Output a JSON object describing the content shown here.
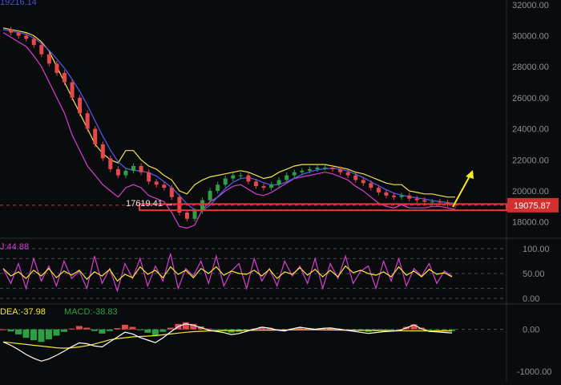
{
  "header": {
    "top_value_text": "19216.14"
  },
  "main_chart": {
    "price_axis_ticks": [
      "32000.00",
      "30000.00",
      "28000.00",
      "26000.00",
      "24000.00",
      "22000.00",
      "20000.00",
      "18000.00"
    ],
    "current_price": "19075.87",
    "low_annotation": "17619.41",
    "colors": {
      "background": "#0a0b0d",
      "candle_up": "#2ea043",
      "candle_down": "#e5484d",
      "upper_band": "#f2e34b",
      "lower_band": "#d63fd2",
      "ma": "#4f59e6",
      "support_box": "#e53935",
      "arrow": "#f5e92a",
      "price_tag": "#d32f2f"
    }
  },
  "stoch_panel": {
    "label": "J:44.88",
    "axis_ticks": [
      "100.00",
      "50.00",
      "0.00"
    ],
    "colors": {
      "k": "#f5e92a",
      "d": "#d63fd2"
    }
  },
  "macd_panel": {
    "dea_label": "DEA:-37.98",
    "macd_label": "MACD:-38.83",
    "axis_ticks": [
      "0.00",
      "-1000.00"
    ],
    "colors": {
      "dif": "#ffffff",
      "dea": "#f5e92a",
      "hist_up": "#2ea043",
      "hist_down": "#e5484d"
    }
  },
  "chart_data": [
    {
      "type": "candlestick",
      "y_ticks": [
        18000,
        20000,
        22000,
        24000,
        26000,
        28000,
        30000,
        32000
      ],
      "ylim": [
        17000,
        32300
      ],
      "grid": false,
      "series": [
        {
          "kind": "close",
          "values": [
            30400,
            30200,
            30000,
            29800,
            29400,
            28800,
            28200,
            27600,
            27000,
            26000,
            25000,
            24000,
            23000,
            22100,
            21400,
            21000,
            21300,
            21600,
            21200,
            20600,
            20400,
            20200,
            19600,
            18600,
            18200,
            18700,
            19400,
            20000,
            20400,
            20800,
            21000,
            21000,
            20600,
            20300,
            20200,
            20400,
            20700,
            21000,
            21200,
            21300,
            21400,
            21500,
            21500,
            21400,
            21200,
            21000,
            20700,
            20500,
            20200,
            19900,
            19700,
            19600,
            19700,
            19500,
            19400,
            19300,
            19300,
            19250,
            19150,
            19075.87
          ]
        },
        {
          "kind": "upper_band",
          "values": [
            30500,
            30400,
            30300,
            30200,
            30000,
            29600,
            29000,
            28000,
            27000,
            26000,
            25000,
            24000,
            23000,
            22400,
            22000,
            21800,
            22600,
            22600,
            22000,
            21600,
            21400,
            21000,
            20700,
            20000,
            19800,
            20400,
            20700,
            20900,
            21000,
            21100,
            21200,
            21300,
            21200,
            21000,
            20800,
            20900,
            21200,
            21400,
            21600,
            21700,
            21700,
            21700,
            21700,
            21600,
            21500,
            21400,
            21200,
            21100,
            20900,
            20700,
            20500,
            20400,
            20400,
            20000,
            19900,
            19800,
            19800,
            19700,
            19600,
            19600
          ]
        },
        {
          "kind": "lower_band",
          "values": [
            30200,
            29900,
            29600,
            29300,
            28700,
            28000,
            27000,
            26000,
            25000,
            23600,
            22600,
            21600,
            21000,
            20400,
            20000,
            19600,
            20200,
            20400,
            20200,
            19700,
            19500,
            19300,
            18600,
            17700,
            17600,
            17800,
            18800,
            19300,
            19600,
            20000,
            20300,
            20400,
            20100,
            19800,
            19700,
            19900,
            20200,
            20500,
            20800,
            20900,
            21000,
            21100,
            21200,
            21100,
            20900,
            20700,
            20300,
            20000,
            19600,
            19200,
            19000,
            18900,
            19100,
            18900,
            18900,
            18900,
            19000,
            19000,
            18900,
            18800
          ]
        }
      ],
      "annotations": {
        "low": 17619.41,
        "current": 19075.87,
        "support_zone": [
          18750,
          19150
        ]
      }
    },
    {
      "type": "line",
      "ylim": [
        0,
        100
      ],
      "series": [
        {
          "name": "J",
          "values": [
            60,
            30,
            70,
            20,
            80,
            35,
            65,
            25,
            75,
            40,
            55,
            20,
            85,
            30,
            60,
            15,
            70,
            40,
            80,
            25,
            65,
            35,
            90,
            20,
            60,
            45,
            75,
            30,
            85,
            25,
            55,
            70,
            20,
            80,
            35,
            60,
            25,
            75,
            45,
            65,
            30,
            80,
            20,
            70,
            40,
            85,
            30,
            55,
            65,
            20,
            75,
            35,
            80,
            25,
            60,
            45,
            70,
            30,
            55,
            44.88
          ]
        }
      ]
    },
    {
      "type": "bar",
      "ylim": [
        -1100,
        300
      ],
      "series": [
        {
          "name": "MACD",
          "values": [
            0,
            -50,
            -120,
            -200,
            -260,
            -300,
            -240,
            -150,
            -60,
            20,
            80,
            40,
            -40,
            -100,
            -40,
            30,
            110,
            60,
            -20,
            -80,
            -140,
            -60,
            40,
            130,
            170,
            130,
            70,
            20,
            -10,
            -40,
            -80,
            -60,
            -20,
            20,
            60,
            40,
            0,
            -20,
            20,
            50,
            30,
            10,
            30,
            40,
            20,
            0,
            -20,
            -40,
            -60,
            -40,
            -20,
            -10,
            0,
            60,
            120,
            40,
            -10,
            -20,
            -30,
            -38.83
          ]
        },
        {
          "name": "DEA",
          "values": [
            -300,
            -320,
            -340,
            -360,
            -380,
            -400,
            -420,
            -440,
            -450,
            -440,
            -420,
            -390,
            -350,
            -300,
            -250,
            -220,
            -200,
            -180,
            -170,
            -160,
            -150,
            -130,
            -110,
            -90,
            -70,
            -55,
            -45,
            -40,
            -35,
            -30,
            -28,
            -26,
            -24,
            -22,
            -20,
            -18,
            -16,
            -14,
            -12,
            -10,
            -10,
            -10,
            -12,
            -14,
            -16,
            -18,
            -20,
            -22,
            -25,
            -28,
            -30,
            -32,
            -34,
            -35,
            -36,
            -36,
            -37,
            -37,
            -38,
            -37.98
          ]
        }
      ]
    }
  ]
}
